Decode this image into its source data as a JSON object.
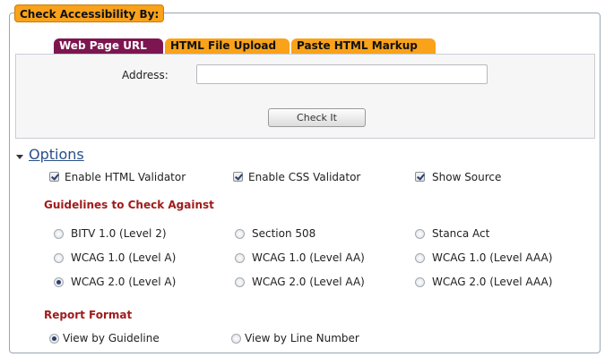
{
  "legend": "Check Accessibility By:",
  "tabs": {
    "url": "Web Page URL",
    "file": "HTML File Upload",
    "paste": "Paste HTML Markup"
  },
  "address": {
    "label": "Address:",
    "value": ""
  },
  "check_button": "Check It",
  "options": {
    "title": "Options",
    "validators": [
      {
        "label": "Enable HTML Validator",
        "checked": true
      },
      {
        "label": "Enable CSS Validator",
        "checked": true
      },
      {
        "label": "Show Source",
        "checked": true
      }
    ]
  },
  "guidelines": {
    "title": "Guidelines to Check Against",
    "items": [
      {
        "label": "BITV 1.0 (Level 2)",
        "selected": false
      },
      {
        "label": "Section 508",
        "selected": false
      },
      {
        "label": "Stanca Act",
        "selected": false
      },
      {
        "label": "WCAG 1.0 (Level A)",
        "selected": false
      },
      {
        "label": "WCAG 1.0 (Level AA)",
        "selected": false
      },
      {
        "label": "WCAG 1.0 (Level AAA)",
        "selected": false
      },
      {
        "label": "WCAG 2.0 (Level A)",
        "selected": true
      },
      {
        "label": "WCAG 2.0 (Level AA)",
        "selected": false
      },
      {
        "label": "WCAG 2.0 (Level AAA)",
        "selected": false
      }
    ]
  },
  "report": {
    "title": "Report Format",
    "items": [
      {
        "label": "View by Guideline",
        "selected": true
      },
      {
        "label": "View by Line Number",
        "selected": false
      }
    ]
  },
  "colors": {
    "accent_orange": "#f9a21a",
    "active_tab": "#7d1650",
    "section_title": "#a01c1c",
    "link_blue": "#2a4f86"
  },
  "icons": [
    "checkbox-icon",
    "radio-icon",
    "collapse-arrow-icon"
  ]
}
